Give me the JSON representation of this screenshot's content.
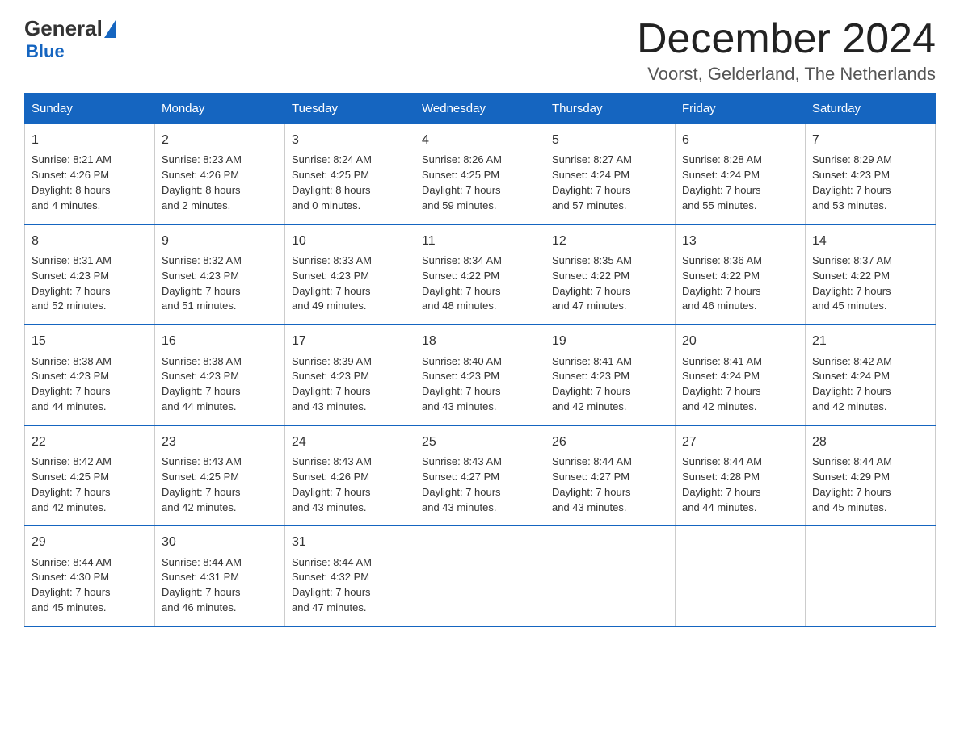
{
  "logo": {
    "general": "General",
    "blue": "Blue"
  },
  "title": {
    "month_year": "December 2024",
    "location": "Voorst, Gelderland, The Netherlands"
  },
  "days_of_week": [
    "Sunday",
    "Monday",
    "Tuesday",
    "Wednesday",
    "Thursday",
    "Friday",
    "Saturday"
  ],
  "weeks": [
    [
      {
        "day": "1",
        "sunrise": "8:21 AM",
        "sunset": "4:26 PM",
        "daylight": "8 hours and 4 minutes."
      },
      {
        "day": "2",
        "sunrise": "8:23 AM",
        "sunset": "4:26 PM",
        "daylight": "8 hours and 2 minutes."
      },
      {
        "day": "3",
        "sunrise": "8:24 AM",
        "sunset": "4:25 PM",
        "daylight": "8 hours and 0 minutes."
      },
      {
        "day": "4",
        "sunrise": "8:26 AM",
        "sunset": "4:25 PM",
        "daylight": "7 hours and 59 minutes."
      },
      {
        "day": "5",
        "sunrise": "8:27 AM",
        "sunset": "4:24 PM",
        "daylight": "7 hours and 57 minutes."
      },
      {
        "day": "6",
        "sunrise": "8:28 AM",
        "sunset": "4:24 PM",
        "daylight": "7 hours and 55 minutes."
      },
      {
        "day": "7",
        "sunrise": "8:29 AM",
        "sunset": "4:23 PM",
        "daylight": "7 hours and 53 minutes."
      }
    ],
    [
      {
        "day": "8",
        "sunrise": "8:31 AM",
        "sunset": "4:23 PM",
        "daylight": "7 hours and 52 minutes."
      },
      {
        "day": "9",
        "sunrise": "8:32 AM",
        "sunset": "4:23 PM",
        "daylight": "7 hours and 51 minutes."
      },
      {
        "day": "10",
        "sunrise": "8:33 AM",
        "sunset": "4:23 PM",
        "daylight": "7 hours and 49 minutes."
      },
      {
        "day": "11",
        "sunrise": "8:34 AM",
        "sunset": "4:22 PM",
        "daylight": "7 hours and 48 minutes."
      },
      {
        "day": "12",
        "sunrise": "8:35 AM",
        "sunset": "4:22 PM",
        "daylight": "7 hours and 47 minutes."
      },
      {
        "day": "13",
        "sunrise": "8:36 AM",
        "sunset": "4:22 PM",
        "daylight": "7 hours and 46 minutes."
      },
      {
        "day": "14",
        "sunrise": "8:37 AM",
        "sunset": "4:22 PM",
        "daylight": "7 hours and 45 minutes."
      }
    ],
    [
      {
        "day": "15",
        "sunrise": "8:38 AM",
        "sunset": "4:23 PM",
        "daylight": "7 hours and 44 minutes."
      },
      {
        "day": "16",
        "sunrise": "8:38 AM",
        "sunset": "4:23 PM",
        "daylight": "7 hours and 44 minutes."
      },
      {
        "day": "17",
        "sunrise": "8:39 AM",
        "sunset": "4:23 PM",
        "daylight": "7 hours and 43 minutes."
      },
      {
        "day": "18",
        "sunrise": "8:40 AM",
        "sunset": "4:23 PM",
        "daylight": "7 hours and 43 minutes."
      },
      {
        "day": "19",
        "sunrise": "8:41 AM",
        "sunset": "4:23 PM",
        "daylight": "7 hours and 42 minutes."
      },
      {
        "day": "20",
        "sunrise": "8:41 AM",
        "sunset": "4:24 PM",
        "daylight": "7 hours and 42 minutes."
      },
      {
        "day": "21",
        "sunrise": "8:42 AM",
        "sunset": "4:24 PM",
        "daylight": "7 hours and 42 minutes."
      }
    ],
    [
      {
        "day": "22",
        "sunrise": "8:42 AM",
        "sunset": "4:25 PM",
        "daylight": "7 hours and 42 minutes."
      },
      {
        "day": "23",
        "sunrise": "8:43 AM",
        "sunset": "4:25 PM",
        "daylight": "7 hours and 42 minutes."
      },
      {
        "day": "24",
        "sunrise": "8:43 AM",
        "sunset": "4:26 PM",
        "daylight": "7 hours and 43 minutes."
      },
      {
        "day": "25",
        "sunrise": "8:43 AM",
        "sunset": "4:27 PM",
        "daylight": "7 hours and 43 minutes."
      },
      {
        "day": "26",
        "sunrise": "8:44 AM",
        "sunset": "4:27 PM",
        "daylight": "7 hours and 43 minutes."
      },
      {
        "day": "27",
        "sunrise": "8:44 AM",
        "sunset": "4:28 PM",
        "daylight": "7 hours and 44 minutes."
      },
      {
        "day": "28",
        "sunrise": "8:44 AM",
        "sunset": "4:29 PM",
        "daylight": "7 hours and 45 minutes."
      }
    ],
    [
      {
        "day": "29",
        "sunrise": "8:44 AM",
        "sunset": "4:30 PM",
        "daylight": "7 hours and 45 minutes."
      },
      {
        "day": "30",
        "sunrise": "8:44 AM",
        "sunset": "4:31 PM",
        "daylight": "7 hours and 46 minutes."
      },
      {
        "day": "31",
        "sunrise": "8:44 AM",
        "sunset": "4:32 PM",
        "daylight": "7 hours and 47 minutes."
      },
      null,
      null,
      null,
      null
    ]
  ],
  "labels": {
    "sunrise": "Sunrise:",
    "sunset": "Sunset:",
    "daylight": "Daylight:"
  }
}
